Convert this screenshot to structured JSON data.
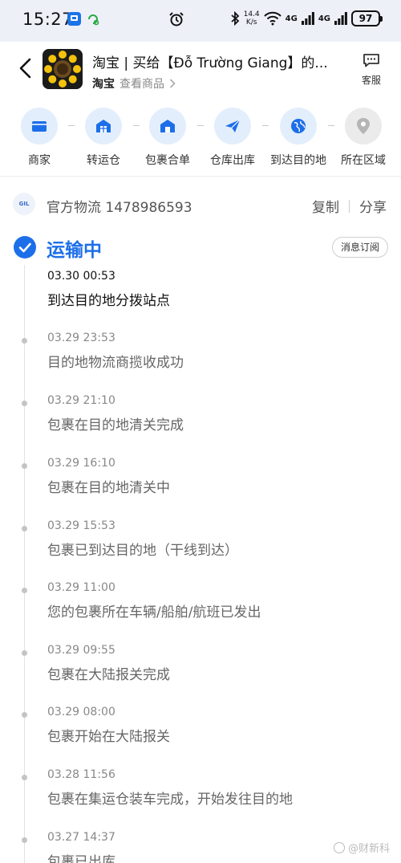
{
  "status_bar": {
    "time": "15:27",
    "net_speed_top": "14.4",
    "net_speed_unit": "K/s",
    "sig1": "4G",
    "sig2": "4G",
    "battery": "97"
  },
  "header": {
    "title": "淘宝 | 买给【Đỗ Trường Giang】的...",
    "platform": "淘宝",
    "view_goods": "查看商品",
    "service_label": "客服"
  },
  "steps": [
    {
      "label": "商家",
      "icon": "store-icon",
      "active": true
    },
    {
      "label": "转运仓",
      "icon": "warehouse-icon",
      "active": true
    },
    {
      "label": "包裹合单",
      "icon": "package-merge-icon",
      "active": true
    },
    {
      "label": "仓库出库",
      "icon": "paper-plane-icon",
      "active": true
    },
    {
      "label": "到达目的地",
      "icon": "globe-icon",
      "active": true
    },
    {
      "label": "所在区域",
      "icon": "location-pin-icon",
      "active": false
    }
  ],
  "tracking": {
    "carrier": "官方物流 1478986593",
    "copy_label": "复制",
    "share_label": "分享"
  },
  "status": {
    "title": "运输中",
    "subscribe_label": "消息订阅"
  },
  "events": [
    {
      "time": "03.30 00:53",
      "desc": "到达目的地分拨站点"
    },
    {
      "time": "03.29 23:53",
      "desc": "目的地物流商揽收成功"
    },
    {
      "time": "03.29 21:10",
      "desc": "包裹在目的地清关完成"
    },
    {
      "time": "03.29 16:10",
      "desc": "包裹在目的地清关中"
    },
    {
      "time": "03.29 15:53",
      "desc": "包裹已到达目的地（干线到达）"
    },
    {
      "time": "03.29 11:00",
      "desc": "您的包裹所在车辆/船舶/航班已发出"
    },
    {
      "time": "03.29 09:55",
      "desc": "包裹在大陆报关完成"
    },
    {
      "time": "03.29 08:00",
      "desc": "包裹开始在大陆报关"
    },
    {
      "time": "03.28 11:56",
      "desc": "包裹在集运仓装车完成，开始发往目的地"
    },
    {
      "time": "03.27 14:37",
      "desc": "包裹已出库"
    }
  ],
  "watermark": "@财新科",
  "colors": {
    "accent": "#1d6fe9",
    "step_bg": "#e3eefc"
  }
}
